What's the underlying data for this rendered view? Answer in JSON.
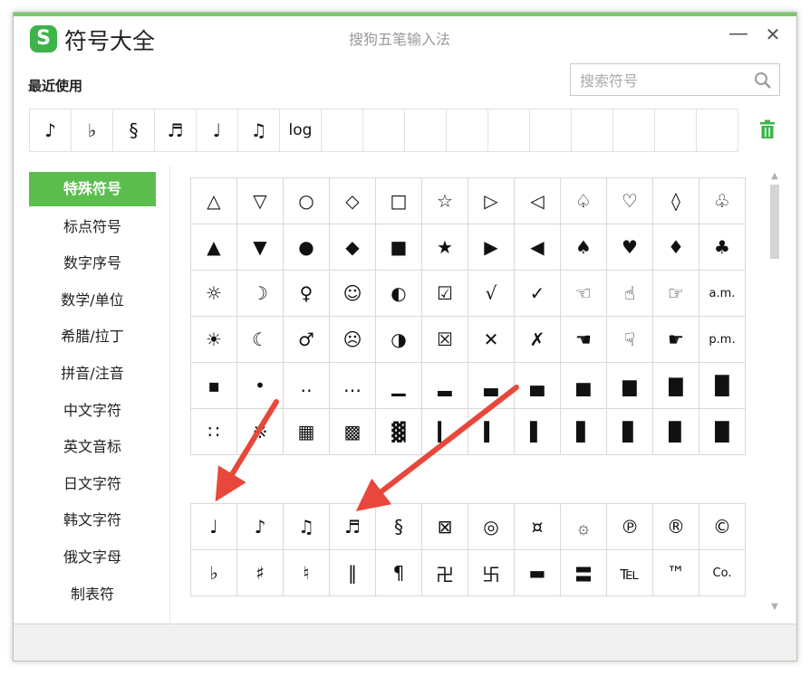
{
  "window": {
    "title": "符号大全",
    "logo_letter": "S",
    "ime_name": "搜狗五笔输入法",
    "minimize": "—",
    "close": "✕"
  },
  "recent": {
    "label": "最近使用",
    "items": [
      "♪",
      "♭",
      "§",
      "♬",
      "♩",
      "♫",
      "log",
      "",
      "",
      "",
      "",
      "",
      "",
      "",
      "",
      "",
      ""
    ]
  },
  "search": {
    "placeholder": "搜索符号",
    "value": ""
  },
  "categories": [
    {
      "label": "特殊符号",
      "active": true
    },
    {
      "label": "标点符号"
    },
    {
      "label": "数字序号"
    },
    {
      "label": "数学/单位"
    },
    {
      "label": "希腊/拉丁"
    },
    {
      "label": "拼音/注音"
    },
    {
      "label": "中文字符"
    },
    {
      "label": "英文音标"
    },
    {
      "label": "日文字符"
    },
    {
      "label": "韩文字符"
    },
    {
      "label": "俄文字母"
    },
    {
      "label": "制表符"
    }
  ],
  "symbols_group1": [
    [
      "△",
      "▽",
      "○",
      "◇",
      "□",
      "☆",
      "▷",
      "◁",
      "♤",
      "♡",
      "◊",
      "♧"
    ],
    [
      "▲",
      "▼",
      "●",
      "◆",
      "■",
      "★",
      "▶",
      "◀",
      "♠",
      "♥",
      "♦",
      "♣"
    ],
    [
      "☼",
      "☽",
      "♀",
      "☺",
      "◐",
      "☑",
      "√",
      "✓",
      "☜",
      "☝",
      "☞",
      "a.m."
    ],
    [
      "☀",
      "☾",
      "♂",
      "☹",
      "◑",
      "☒",
      "✕",
      "✗",
      "☚",
      "☟",
      "☛",
      "p.m."
    ],
    [
      "▪",
      "•",
      "‥",
      "…",
      "▁",
      "▂",
      "▃",
      "▄",
      "▅",
      "▆",
      "▇",
      "█"
    ],
    [
      "∷",
      "※",
      "▦",
      "▩",
      "▓",
      "▎",
      "▍",
      "▌",
      "▋",
      "▊",
      "▉",
      "█"
    ]
  ],
  "symbols_group2": [
    [
      "♩",
      "♪",
      "♫",
      "♬",
      "§",
      "⊠",
      "◎",
      "¤",
      "۞",
      "℗",
      "®",
      "©"
    ],
    [
      "♭",
      "♯",
      "♮",
      "‖",
      "¶",
      "卍",
      "卐",
      "▬",
      "〓",
      "℡",
      "™",
      "Co."
    ]
  ],
  "colors": {
    "accent": "#5cbd4f",
    "logo": "#3eb34a",
    "arrow": "#e8473c"
  }
}
